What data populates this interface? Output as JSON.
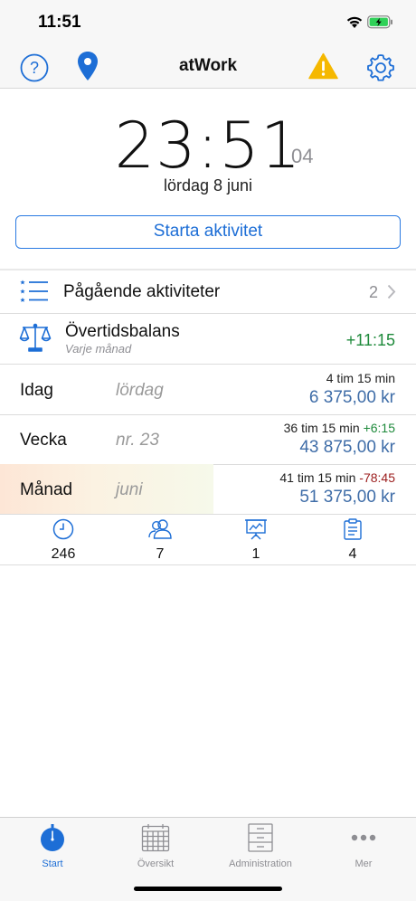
{
  "status_bar": {
    "time": "11:51"
  },
  "nav": {
    "title": "atWork"
  },
  "clock": {
    "time": "23:51",
    "seconds": "04",
    "date": "lördag 8 juni"
  },
  "start_button": {
    "label": "Starta aktivitet"
  },
  "ongoing": {
    "label": "Pågående aktiviteter",
    "count": "2"
  },
  "balance": {
    "label": "Övertidsbalans",
    "sub": "Varje månad",
    "value": "+11:15"
  },
  "periods": [
    {
      "label": "Idag",
      "sub": "lördag",
      "time": "4 tim 15 min",
      "diff": "",
      "money": "6 375,00 kr"
    },
    {
      "label": "Vecka",
      "sub": "nr. 23",
      "time": "36 tim 15 min",
      "diff": "+6:15",
      "money": "43 875,00 kr"
    },
    {
      "label": "Månad",
      "sub": "juni",
      "time": "41 tim 15 min",
      "diff": "-78:45",
      "money": "51 375,00 kr"
    }
  ],
  "stats": [
    {
      "icon": "clock-icon",
      "value": "246"
    },
    {
      "icon": "users-icon",
      "value": "7"
    },
    {
      "icon": "presentation-icon",
      "value": "1"
    },
    {
      "icon": "clipboard-icon",
      "value": "4"
    }
  ],
  "tabs": [
    {
      "label": "Start",
      "icon": "stopwatch-icon",
      "active": true
    },
    {
      "label": "Översikt",
      "icon": "calendar-icon",
      "active": false
    },
    {
      "label": "Administration",
      "icon": "file-cabinet-icon",
      "active": false
    },
    {
      "label": "Mer",
      "icon": "more-dots-icon",
      "active": false
    }
  ],
  "colors": {
    "accent": "#1d6ed6",
    "warning": "#f5b800",
    "positive": "#1e8a3b",
    "negative": "#9b1c1c",
    "money": "#3f6da8"
  }
}
